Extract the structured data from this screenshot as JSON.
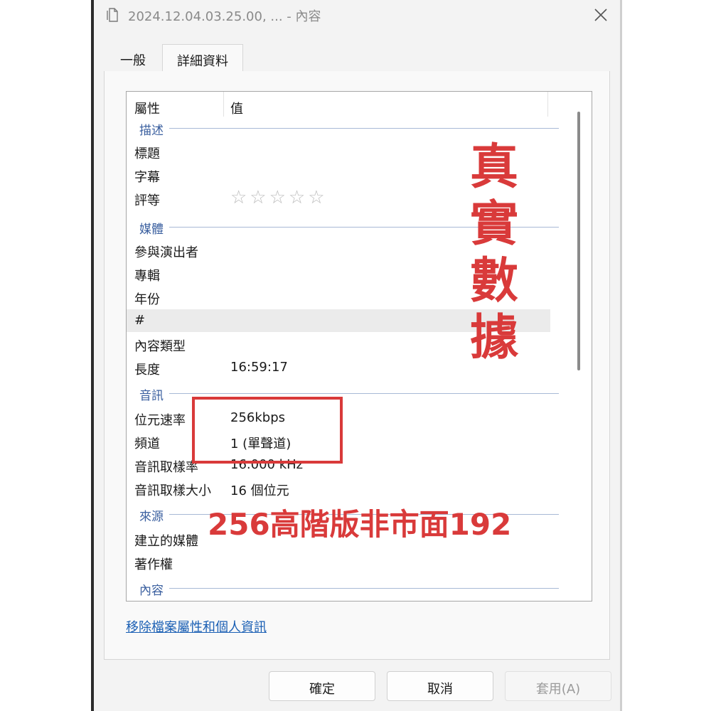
{
  "window": {
    "title": "2024.12.04.03.25.00, ... - 內容"
  },
  "tabs": [
    {
      "label": "一般"
    },
    {
      "label": "詳細資料"
    }
  ],
  "list": {
    "header": {
      "property": "屬性",
      "value": "值"
    },
    "groups": {
      "description": "描述",
      "media": "媒體",
      "audio": "音訊",
      "origin": "來源",
      "content": "內容"
    },
    "rows": {
      "title": {
        "label": "標題",
        "value": ""
      },
      "subtitle": {
        "label": "字幕",
        "value": ""
      },
      "rating": {
        "label": "評等",
        "stars": "☆☆☆☆☆",
        "rating_value": 0,
        "rating_max": 5
      },
      "contributing_artists": {
        "label": "參與演出者",
        "value": ""
      },
      "album": {
        "label": "專輯",
        "value": ""
      },
      "year": {
        "label": "年份",
        "value": ""
      },
      "track_number": {
        "label": "#",
        "value": ""
      },
      "genre": {
        "label": "內容類型",
        "value": ""
      },
      "length": {
        "label": "長度",
        "value": "16:59:17"
      },
      "bit_rate": {
        "label": "位元速率",
        "value": "256kbps"
      },
      "channels": {
        "label": "頻道",
        "value": "1 (單聲道)"
      },
      "sample_rate": {
        "label": "音訊取樣率",
        "value": "16.000 kHz"
      },
      "sample_size": {
        "label": "音訊取樣大小",
        "value": "16 個位元"
      },
      "encoded_by": {
        "label": "建立的媒體",
        "value": ""
      },
      "copyright": {
        "label": "著作權",
        "value": ""
      }
    }
  },
  "remove_link": "移除檔案屬性和個人資訊",
  "buttons": {
    "ok": "確定",
    "cancel": "取消",
    "apply": "套用(A)"
  },
  "overlay": {
    "vertical_chars": [
      "真",
      "實",
      "數",
      "據"
    ],
    "banner": "256高階版非市面192",
    "color": "#d93a3a"
  },
  "colors": {
    "group_text": "#3a5f9f",
    "link": "#1a5fb4"
  }
}
